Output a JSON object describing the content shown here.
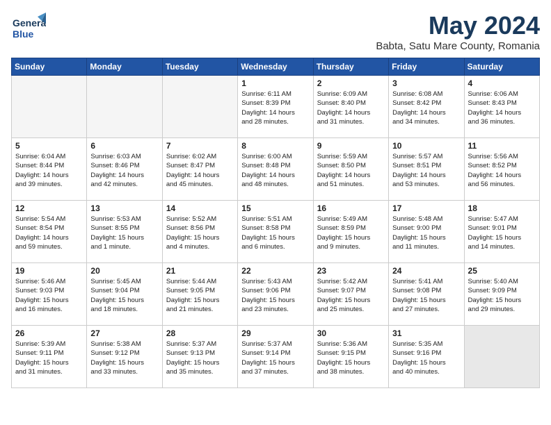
{
  "header": {
    "logo_line1": "General",
    "logo_line2": "Blue",
    "title": "May 2024",
    "subtitle": "Babta, Satu Mare County, Romania"
  },
  "weekdays": [
    "Sunday",
    "Monday",
    "Tuesday",
    "Wednesday",
    "Thursday",
    "Friday",
    "Saturday"
  ],
  "weeks": [
    [
      {
        "day": "",
        "info": ""
      },
      {
        "day": "",
        "info": ""
      },
      {
        "day": "",
        "info": ""
      },
      {
        "day": "1",
        "info": "Sunrise: 6:11 AM\nSunset: 8:39 PM\nDaylight: 14 hours\nand 28 minutes."
      },
      {
        "day": "2",
        "info": "Sunrise: 6:09 AM\nSunset: 8:40 PM\nDaylight: 14 hours\nand 31 minutes."
      },
      {
        "day": "3",
        "info": "Sunrise: 6:08 AM\nSunset: 8:42 PM\nDaylight: 14 hours\nand 34 minutes."
      },
      {
        "day": "4",
        "info": "Sunrise: 6:06 AM\nSunset: 8:43 PM\nDaylight: 14 hours\nand 36 minutes."
      }
    ],
    [
      {
        "day": "5",
        "info": "Sunrise: 6:04 AM\nSunset: 8:44 PM\nDaylight: 14 hours\nand 39 minutes."
      },
      {
        "day": "6",
        "info": "Sunrise: 6:03 AM\nSunset: 8:46 PM\nDaylight: 14 hours\nand 42 minutes."
      },
      {
        "day": "7",
        "info": "Sunrise: 6:02 AM\nSunset: 8:47 PM\nDaylight: 14 hours\nand 45 minutes."
      },
      {
        "day": "8",
        "info": "Sunrise: 6:00 AM\nSunset: 8:48 PM\nDaylight: 14 hours\nand 48 minutes."
      },
      {
        "day": "9",
        "info": "Sunrise: 5:59 AM\nSunset: 8:50 PM\nDaylight: 14 hours\nand 51 minutes."
      },
      {
        "day": "10",
        "info": "Sunrise: 5:57 AM\nSunset: 8:51 PM\nDaylight: 14 hours\nand 53 minutes."
      },
      {
        "day": "11",
        "info": "Sunrise: 5:56 AM\nSunset: 8:52 PM\nDaylight: 14 hours\nand 56 minutes."
      }
    ],
    [
      {
        "day": "12",
        "info": "Sunrise: 5:54 AM\nSunset: 8:54 PM\nDaylight: 14 hours\nand 59 minutes."
      },
      {
        "day": "13",
        "info": "Sunrise: 5:53 AM\nSunset: 8:55 PM\nDaylight: 15 hours\nand 1 minute."
      },
      {
        "day": "14",
        "info": "Sunrise: 5:52 AM\nSunset: 8:56 PM\nDaylight: 15 hours\nand 4 minutes."
      },
      {
        "day": "15",
        "info": "Sunrise: 5:51 AM\nSunset: 8:58 PM\nDaylight: 15 hours\nand 6 minutes."
      },
      {
        "day": "16",
        "info": "Sunrise: 5:49 AM\nSunset: 8:59 PM\nDaylight: 15 hours\nand 9 minutes."
      },
      {
        "day": "17",
        "info": "Sunrise: 5:48 AM\nSunset: 9:00 PM\nDaylight: 15 hours\nand 11 minutes."
      },
      {
        "day": "18",
        "info": "Sunrise: 5:47 AM\nSunset: 9:01 PM\nDaylight: 15 hours\nand 14 minutes."
      }
    ],
    [
      {
        "day": "19",
        "info": "Sunrise: 5:46 AM\nSunset: 9:03 PM\nDaylight: 15 hours\nand 16 minutes."
      },
      {
        "day": "20",
        "info": "Sunrise: 5:45 AM\nSunset: 9:04 PM\nDaylight: 15 hours\nand 18 minutes."
      },
      {
        "day": "21",
        "info": "Sunrise: 5:44 AM\nSunset: 9:05 PM\nDaylight: 15 hours\nand 21 minutes."
      },
      {
        "day": "22",
        "info": "Sunrise: 5:43 AM\nSunset: 9:06 PM\nDaylight: 15 hours\nand 23 minutes."
      },
      {
        "day": "23",
        "info": "Sunrise: 5:42 AM\nSunset: 9:07 PM\nDaylight: 15 hours\nand 25 minutes."
      },
      {
        "day": "24",
        "info": "Sunrise: 5:41 AM\nSunset: 9:08 PM\nDaylight: 15 hours\nand 27 minutes."
      },
      {
        "day": "25",
        "info": "Sunrise: 5:40 AM\nSunset: 9:09 PM\nDaylight: 15 hours\nand 29 minutes."
      }
    ],
    [
      {
        "day": "26",
        "info": "Sunrise: 5:39 AM\nSunset: 9:11 PM\nDaylight: 15 hours\nand 31 minutes."
      },
      {
        "day": "27",
        "info": "Sunrise: 5:38 AM\nSunset: 9:12 PM\nDaylight: 15 hours\nand 33 minutes."
      },
      {
        "day": "28",
        "info": "Sunrise: 5:37 AM\nSunset: 9:13 PM\nDaylight: 15 hours\nand 35 minutes."
      },
      {
        "day": "29",
        "info": "Sunrise: 5:37 AM\nSunset: 9:14 PM\nDaylight: 15 hours\nand 37 minutes."
      },
      {
        "day": "30",
        "info": "Sunrise: 5:36 AM\nSunset: 9:15 PM\nDaylight: 15 hours\nand 38 minutes."
      },
      {
        "day": "31",
        "info": "Sunrise: 5:35 AM\nSunset: 9:16 PM\nDaylight: 15 hours\nand 40 minutes."
      },
      {
        "day": "",
        "info": ""
      }
    ]
  ]
}
